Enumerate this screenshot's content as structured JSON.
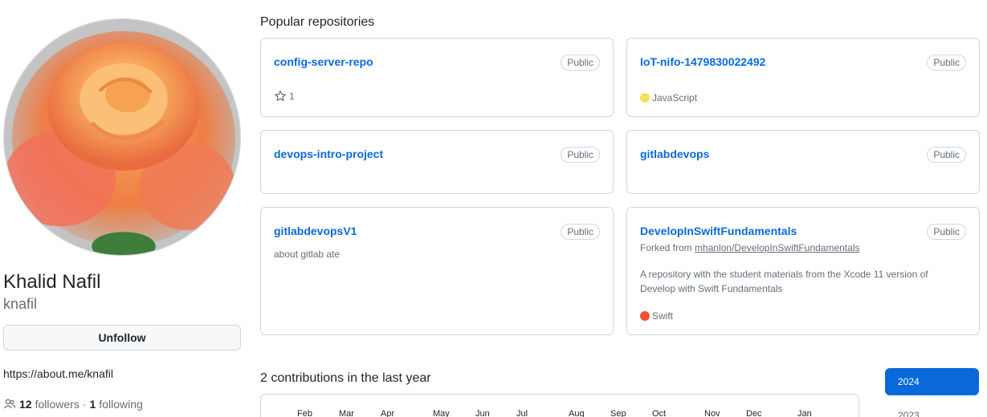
{
  "profile": {
    "name": "Khalid Nafil",
    "login": "knafil",
    "unfollow_label": "Unfollow",
    "url": "https://about.me/knafil",
    "followers_count": "12",
    "followers_label": "followers",
    "separator": "·",
    "following_count": "1",
    "following_label": "following"
  },
  "popular": {
    "title": "Popular repositories",
    "repos": [
      {
        "name": "config-server-repo",
        "visibility": "Public",
        "stars": "1"
      },
      {
        "name": "IoT-nifo-1479830022492",
        "visibility": "Public",
        "language": "JavaScript",
        "language_color": "#f1e05a"
      },
      {
        "name": "devops-intro-project",
        "visibility": "Public"
      },
      {
        "name": "gitlabdevops",
        "visibility": "Public"
      },
      {
        "name": "gitlabdevopsV1",
        "visibility": "Public",
        "description": "about gitlab ate"
      },
      {
        "name": "DevelopInSwiftFundamentals",
        "visibility": "Public",
        "forked_prefix": "Forked from",
        "forked_from": "mhanlon/DevelopInSwiftFundamentals",
        "description": "A repository with the student materials from the Xcode 11 version of Develop with Swift Fundamentals",
        "language": "Swift",
        "language_color": "#F05138"
      }
    ]
  },
  "contributions": {
    "title": "2 contributions in the last year",
    "months": [
      "Feb",
      "Mar",
      "Apr",
      "May",
      "Jun",
      "Jul",
      "Aug",
      "Sep",
      "Oct",
      "Nov",
      "Dec",
      "Jan"
    ],
    "years": [
      "2024",
      "2023"
    ]
  },
  "colors": {
    "accent": "#0969da",
    "border": "#d0d7de",
    "muted": "#656d76"
  }
}
